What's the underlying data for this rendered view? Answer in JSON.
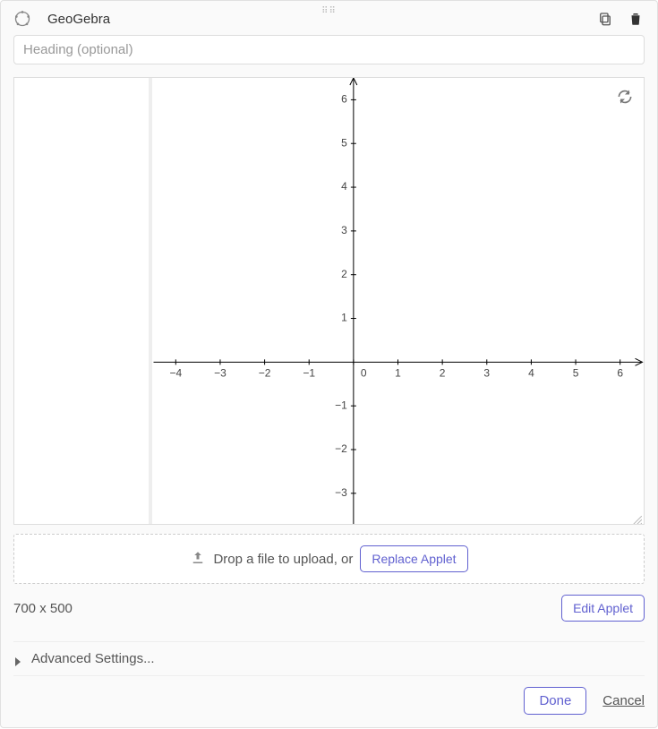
{
  "header": {
    "title": "GeoGebra"
  },
  "heading_placeholder": "Heading (optional)",
  "upload": {
    "prompt": "Drop a file to upload, or",
    "replace_label": "Replace Applet"
  },
  "dimensions": "700 x 500",
  "edit_applet_label": "Edit Applet",
  "advanced_label": "Advanced Settings...",
  "footer": {
    "done": "Done",
    "cancel": "Cancel"
  },
  "chart_data": {
    "type": "scatter",
    "series": [],
    "x_ticks": [
      -4,
      -3,
      -2,
      -1,
      0,
      1,
      2,
      3,
      4,
      5,
      6
    ],
    "y_ticks": [
      -3,
      -2,
      -1,
      0,
      1,
      2,
      3,
      4,
      5,
      6
    ],
    "xlim": [
      -4.5,
      6.5
    ],
    "ylim": [
      -3.7,
      6.5
    ],
    "title": "",
    "xlabel": "",
    "ylabel": ""
  }
}
